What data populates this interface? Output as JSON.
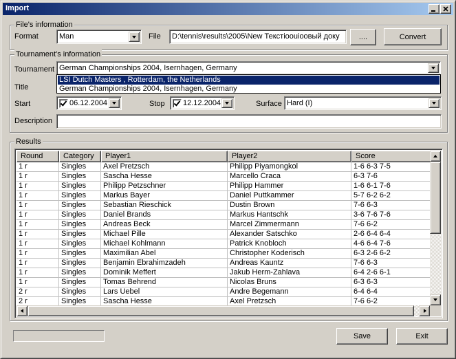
{
  "window": {
    "title": "Import"
  },
  "files_group": {
    "legend": "File's information",
    "format_label": "Format",
    "format_value": "Man",
    "file_label": "File",
    "file_value": "D:\\tennis\\results\\2005\\New Текстioouiоовый доку",
    "browse_label": "....",
    "convert_label": "Convert"
  },
  "tournament_group": {
    "legend": "Tournament's information",
    "tournament_label": "Tournament",
    "tournament_value": "German Championships 2004, Isernhagen, Germany",
    "dropdown_options": [
      "LSI Dutch Masters , Rotterdam, the Netherlands",
      "German Championships 2004, Isernhagen, Germany"
    ],
    "title_label": "Title",
    "start_label": "Start",
    "start_value": "06.12.2004",
    "stop_label": "Stop",
    "stop_value": "12.12.2004",
    "surface_label": "Surface",
    "surface_value": "Hard (I)",
    "description_label": "Description",
    "description_value": ""
  },
  "results_group": {
    "legend": "Results",
    "columns": [
      "Round",
      "Category",
      "Player1",
      "Player2",
      "Score"
    ],
    "rows": [
      [
        "1 r",
        "Singles",
        "Axel Pretzsch",
        "Philipp Piyamongkol",
        "1-6 6-3 7-5"
      ],
      [
        "1 r",
        "Singles",
        "Sascha Hesse",
        "Marcello Craca",
        "6-3 7-6"
      ],
      [
        "1 r",
        "Singles",
        "Philipp Petzschner",
        "Philipp Hammer",
        "1-6 6-1 7-6"
      ],
      [
        "1 r",
        "Singles",
        "Markus Bayer",
        "Daniel Puttkammer",
        "5-7 6-2 6-2"
      ],
      [
        "1 r",
        "Singles",
        "Sebastian Rieschick",
        "Dustin Brown",
        "7-6 6-3"
      ],
      [
        "1 r",
        "Singles",
        "Daniel Brands",
        "Markus Hantschk",
        "3-6 7-6 7-6"
      ],
      [
        "1 r",
        "Singles",
        "Andreas Beck",
        "Marcel Zimmermann",
        "7-6 6-2"
      ],
      [
        "1 r",
        "Singles",
        "Michael Pille",
        "Alexander Satschko",
        "2-6 6-4 6-4"
      ],
      [
        "1 r",
        "Singles",
        "Michael Kohlmann",
        "Patrick Knobloch",
        "4-6 6-4 7-6"
      ],
      [
        "1 r",
        "Singles",
        "Maximilian Abel",
        "Christopher Koderisch",
        "6-3 2-6 6-2"
      ],
      [
        "1 r",
        "Singles",
        "Benjamin Ebrahimzadeh",
        "Andreas Kauntz",
        "7-6 6-3"
      ],
      [
        "1 r",
        "Singles",
        "Dominik Meffert",
        "Jakub Herm-Zahlava",
        "6-4 2-6 6-1"
      ],
      [
        "1 r",
        "Singles",
        "Tomas Behrend",
        "Nicolas Bruns",
        "6-3 6-3"
      ],
      [
        "2 r",
        "Singles",
        "Lars Uebel",
        "Andre Begemann",
        "6-4 6-4"
      ],
      [
        "2 r",
        "Singles",
        "Sascha Hesse",
        "Axel Pretzsch",
        "7-6 6-2"
      ]
    ]
  },
  "footer": {
    "progress_fraction": 0,
    "save_label": "Save",
    "exit_label": "Exit"
  },
  "colors": {
    "titlebar_start": "#0a246a",
    "titlebar_end": "#a6caf0",
    "selection": "#0a246a",
    "face": "#d4d0c8"
  },
  "icons": [
    "minimize-icon",
    "maximize-icon",
    "close-icon",
    "chevron-down-icon",
    "checkbox-checked-icon",
    "scroll-up-icon",
    "scroll-down-icon",
    "scroll-left-icon",
    "scroll-right-icon"
  ]
}
